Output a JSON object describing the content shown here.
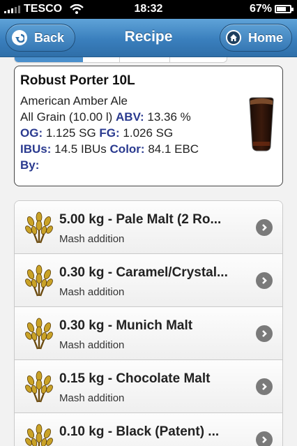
{
  "status_bar": {
    "carrier": "TESCO",
    "time": "18:32",
    "battery": "67%",
    "battery_level": 0.67,
    "icons": [
      "signal-icon",
      "wifi-icon",
      "battery-icon"
    ]
  },
  "navbar": {
    "title": "Recipe",
    "back_label": "Back",
    "home_label": "Home",
    "icons": [
      "back-arrow-icon",
      "home-icon"
    ]
  },
  "recipe": {
    "name": "Robust Porter 10L",
    "style": "American Amber Ale",
    "type_volume": "All Grain (10.00 l)",
    "abv_label": "ABV:",
    "abv_value": "13.36 %",
    "og_label": "OG:",
    "og_value": "1.125 SG",
    "fg_label": "FG:",
    "fg_value": "1.026 SG",
    "ibu_label": "IBUs:",
    "ibu_value": "14.5 IBUs",
    "color_label": "Color:",
    "color_value": "84.1 EBC",
    "by_label": "By:",
    "image_icon": "beer-glass-icon"
  },
  "ingredients": [
    {
      "title": "5.00 kg - Pale Malt (2 Ro...",
      "sub": "Mash addition",
      "icon": "grain-icon"
    },
    {
      "title": "0.30 kg - Caramel/Crystal...",
      "sub": "Mash addition",
      "icon": "grain-icon"
    },
    {
      "title": "0.30 kg - Munich Malt",
      "sub": "Mash addition",
      "icon": "grain-icon"
    },
    {
      "title": "0.15 kg - Chocolate Malt",
      "sub": "Mash addition",
      "icon": "grain-icon"
    },
    {
      "title": "0.10 kg - Black (Patent) ...",
      "sub": "",
      "icon": "grain-icon"
    }
  ],
  "colors": {
    "nav_blue": "#3a7fbd",
    "label_blue": "#2a3a8f"
  }
}
